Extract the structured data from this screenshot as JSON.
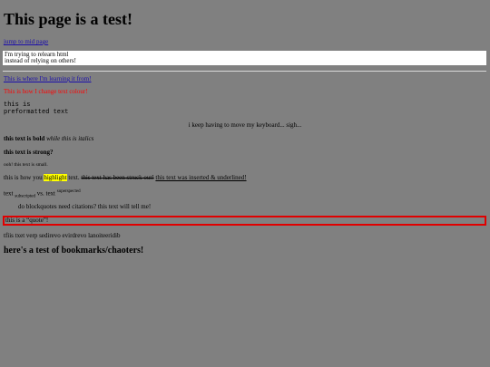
{
  "page": {
    "title": "This page is a test!",
    "jump_link": "jump to mid page",
    "white_box": {
      "line1": "I'm trying to relearn html",
      "line2": "instead of relying on others!"
    },
    "learning_link": "This is where I'm learning it from!",
    "red_text": "This is how I change text colour!",
    "pre_lines": [
      "this is",
      "preformatted text"
    ],
    "centered_text": "i keep having to move my keyboard... sigh...",
    "bold_italic": {
      "bold": "this text is bold",
      "italic": "while this is italics"
    },
    "strong_text": "this text is strong?",
    "small_text": "ooh! this text is small.",
    "highlight_line": {
      "prefix": "this is how you ",
      "highlight": "highlight",
      "middle": " text. ",
      "struck": "this text has been struck out!",
      "space": " ",
      "inserted": "this text was inserted & underlined!"
    },
    "subsup_line": {
      "text1": "text ",
      "sub": "subscripted",
      "vs": " vs. text ",
      "sup": "superspected"
    },
    "blockquote": "do blockquotes need citations? this text will tell me!",
    "quote_line": "this is a “quote”!",
    "reversed_text": "tfiis txet verp sedirevo evirdrevo lanoiteeridib",
    "bookmarks_heading": "here's a test of bookmarks/chaoters!"
  },
  "colors": {
    "background": "#808080",
    "link": "#1a0dab",
    "red": "#ff0000",
    "highlight": "#ffff00",
    "quote_border": "#e00000"
  }
}
